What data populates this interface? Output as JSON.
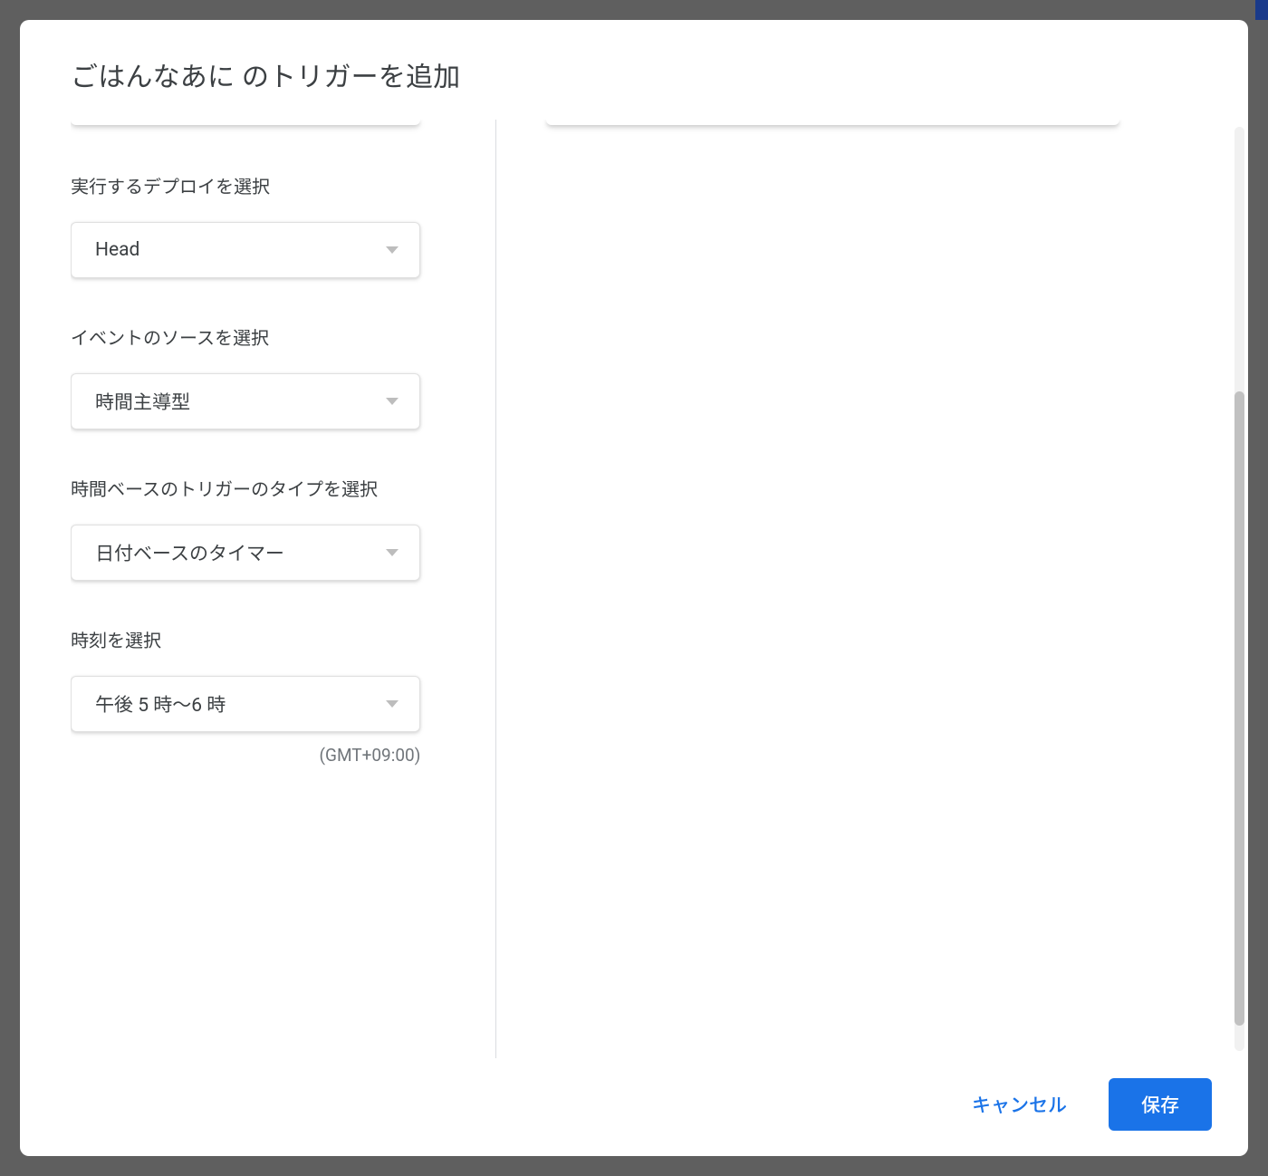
{
  "dialog": {
    "title": "ごはんなあに のトリガーを追加"
  },
  "form": {
    "deploy": {
      "label": "実行するデプロイを選択",
      "value": "Head"
    },
    "eventSource": {
      "label": "イベントのソースを選択",
      "value": "時間主導型"
    },
    "triggerType": {
      "label": "時間ベースのトリガーのタイプを選択",
      "value": "日付ベースのタイマー"
    },
    "timeOfDay": {
      "label": "時刻を選択",
      "value": "午後 5 時～6 時",
      "timezone": "(GMT+09:00)"
    }
  },
  "actions": {
    "cancel": "キャンセル",
    "save": "保存"
  }
}
